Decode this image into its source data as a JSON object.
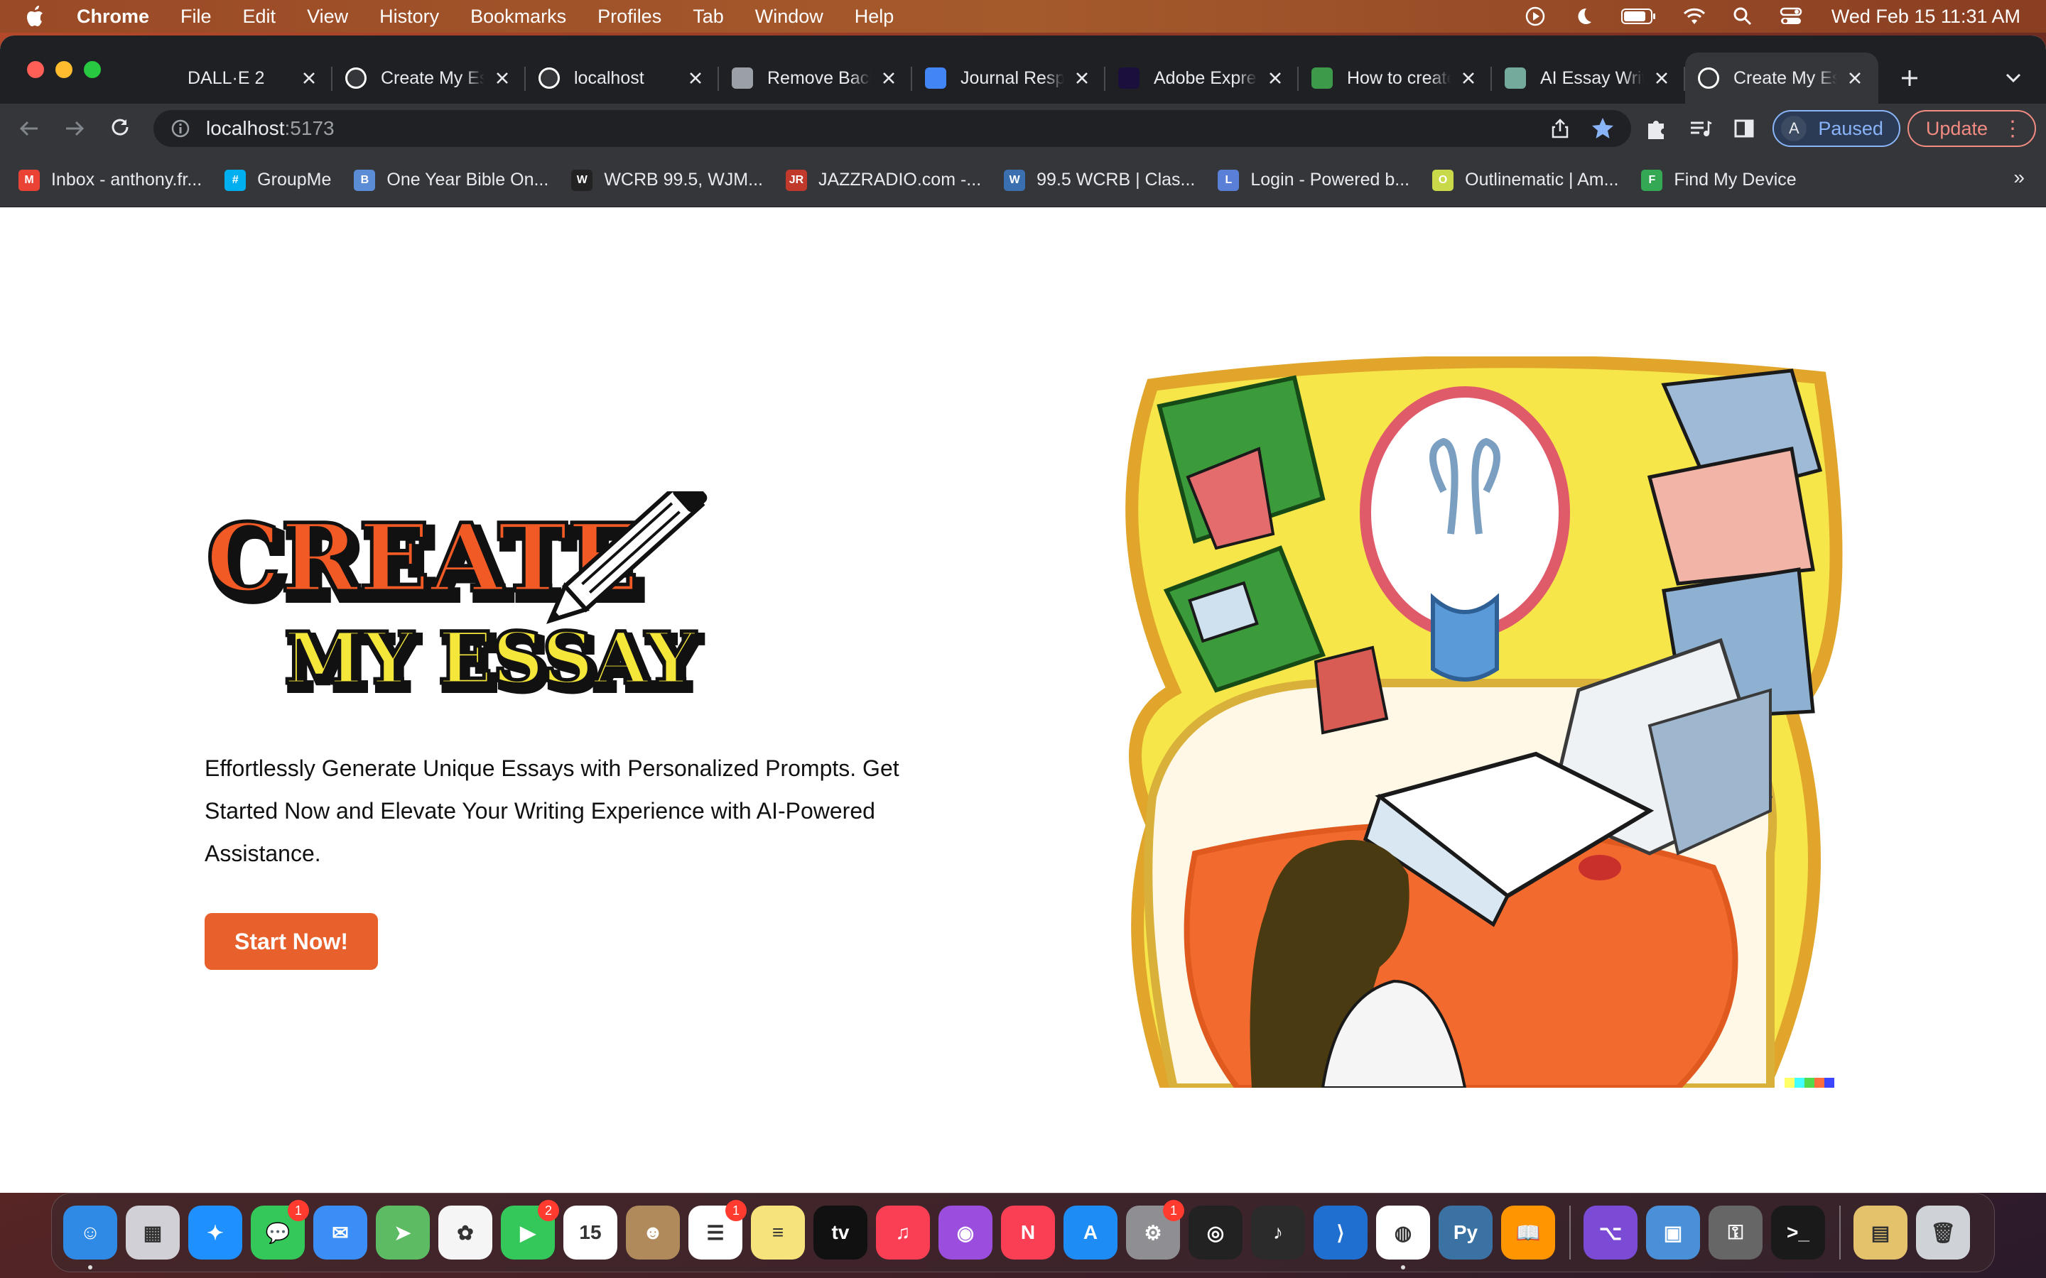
{
  "menubar": {
    "app": "Chrome",
    "items": [
      "File",
      "Edit",
      "View",
      "History",
      "Bookmarks",
      "Profiles",
      "Tab",
      "Window",
      "Help"
    ],
    "clock": "Wed Feb 15  11:31 AM",
    "status_icons": [
      "play-circle-icon",
      "moon-icon",
      "battery-icon",
      "wifi-icon",
      "spotlight-search-icon",
      "control-center-icon"
    ]
  },
  "tabs": [
    {
      "title": "DALL·E 2",
      "icon": "openai-icon",
      "color": "#1f2023"
    },
    {
      "title": "Create My Essay",
      "icon": "compass-icon",
      "color": "#ffffff"
    },
    {
      "title": "localhost",
      "icon": "compass-icon",
      "color": "#ffffff"
    },
    {
      "title": "Remove Background",
      "icon": "layers-icon",
      "color": "#9aa0a6"
    },
    {
      "title": "Journal Response",
      "icon": "docs-icon",
      "color": "#4285f4"
    },
    {
      "title": "Adobe Express",
      "icon": "adobe-icon",
      "color": "#1a0f3d"
    },
    {
      "title": "How to create",
      "icon": "link-icon",
      "color": "#3c9a4a"
    },
    {
      "title": "AI Essay Writer",
      "icon": "chatgpt-icon",
      "color": "#74aa9c"
    },
    {
      "title": "Create My Essay",
      "icon": "compass-icon",
      "color": "#ffffff",
      "active": true
    }
  ],
  "toolbar": {
    "url_host": "localhost",
    "url_port": ":5173",
    "profile_initial": "A",
    "profile_status": "Paused",
    "update_label": "Update"
  },
  "bookmarks": [
    {
      "label": "Inbox - anthony.fr...",
      "icon": "gmail-icon",
      "color": "#ea4335",
      "glyph": "M"
    },
    {
      "label": "GroupMe",
      "icon": "groupme-icon",
      "color": "#00aff0",
      "glyph": "#"
    },
    {
      "label": "One Year Bible On...",
      "icon": "bible-icon",
      "color": "#5b8dd6",
      "glyph": "B"
    },
    {
      "label": "WCRB 99.5, WJM...",
      "icon": "radio-icon",
      "color": "#222222",
      "glyph": "W"
    },
    {
      "label": "JAZZRADIO.com -...",
      "icon": "jazzradio-icon",
      "color": "#c0392b",
      "glyph": "JR"
    },
    {
      "label": "99.5 WCRB | Clas...",
      "icon": "wcrb-icon",
      "color": "#3a6fb0",
      "glyph": "W"
    },
    {
      "label": "Login - Powered b...",
      "icon": "login-icon",
      "color": "#5a7fd6",
      "glyph": "L"
    },
    {
      "label": "Outlinematic | Am...",
      "icon": "outlinematic-icon",
      "color": "#c9d94a",
      "glyph": "O"
    },
    {
      "label": "Find My Device",
      "icon": "find-device-icon",
      "color": "#34a853",
      "glyph": "F"
    }
  ],
  "page": {
    "logo_line1": "CREATE",
    "logo_line2": "MY ESSAY",
    "tagline": "Effortlessly Generate Unique Essays with Personalized Prompts. Get Started Now and Elevate Your Writing Experience with AI-Powered Assistance.",
    "cta_label": "Start Now!",
    "accent": "#e8612c"
  },
  "dock": [
    {
      "name": "finder",
      "color": "#2f8ae6",
      "glyph": "☺",
      "running": true
    },
    {
      "name": "launchpad",
      "color": "#d0d0d6",
      "glyph": "▦"
    },
    {
      "name": "safari",
      "color": "#1e90ff",
      "glyph": "✦"
    },
    {
      "name": "messages",
      "color": "#34c759",
      "glyph": "💬",
      "badge": "1"
    },
    {
      "name": "mail",
      "color": "#3b8ef5",
      "glyph": "✉"
    },
    {
      "name": "maps",
      "color": "#5dbb63",
      "glyph": "➤"
    },
    {
      "name": "photos",
      "color": "#f5f5f5",
      "glyph": "✿"
    },
    {
      "name": "facetime",
      "color": "#34c759",
      "glyph": "▶",
      "badge": "2"
    },
    {
      "name": "calendar",
      "color": "#ffffff",
      "glyph": "15"
    },
    {
      "name": "contacts",
      "color": "#b08a5a",
      "glyph": "☻"
    },
    {
      "name": "reminders",
      "color": "#ffffff",
      "glyph": "☰",
      "badge": "1"
    },
    {
      "name": "notes",
      "color": "#f7e37b",
      "glyph": "≡"
    },
    {
      "name": "apple-tv",
      "color": "#111111",
      "glyph": "tv"
    },
    {
      "name": "music",
      "color": "#fa3f55",
      "glyph": "♫"
    },
    {
      "name": "podcasts",
      "color": "#9b4dde",
      "glyph": "◉"
    },
    {
      "name": "news",
      "color": "#fa3f55",
      "glyph": "N"
    },
    {
      "name": "app-store",
      "color": "#1e8cf5",
      "glyph": "A"
    },
    {
      "name": "system-settings",
      "color": "#8e8e93",
      "glyph": "⚙",
      "badge": "1"
    },
    {
      "name": "chatgpt-app",
      "color": "#222222",
      "glyph": "◎"
    },
    {
      "name": "garageband",
      "color": "#2b2b2b",
      "glyph": "♪"
    },
    {
      "name": "vscode",
      "color": "#1f6fd1",
      "glyph": "⟩"
    },
    {
      "name": "chrome",
      "color": "#ffffff",
      "glyph": "◍",
      "running": true
    },
    {
      "name": "python",
      "color": "#3b72a4",
      "glyph": "Py"
    },
    {
      "name": "books",
      "color": "#ff9500",
      "glyph": "📖"
    },
    {
      "divider": true
    },
    {
      "name": "github-desktop",
      "color": "#7b4bd6",
      "glyph": "⌥"
    },
    {
      "name": "preview",
      "color": "#4a90d9",
      "glyph": "▣"
    },
    {
      "name": "keychain",
      "color": "#666666",
      "glyph": "⚿"
    },
    {
      "name": "terminal",
      "color": "#1a1a1a",
      "glyph": ">_"
    },
    {
      "divider": true
    },
    {
      "name": "downloads-stack",
      "color": "#e4c26b",
      "glyph": "▤"
    },
    {
      "name": "trash",
      "color": "#cfd3d8",
      "glyph": "🗑"
    }
  ]
}
